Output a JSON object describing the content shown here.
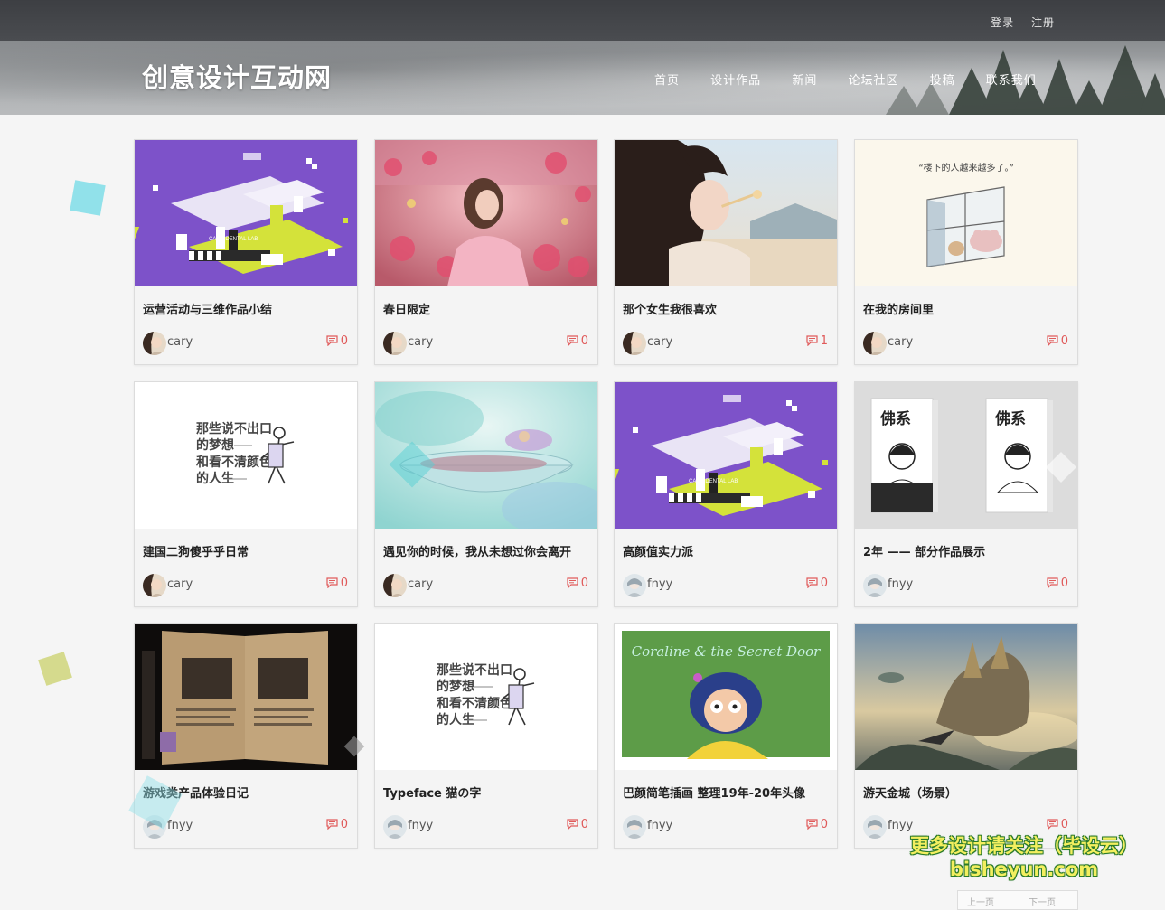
{
  "topbar": {
    "login": "登录",
    "register": "注册"
  },
  "site": {
    "name": "创意设计互动网"
  },
  "nav": [
    "首页",
    "设计作品",
    "新闻",
    "论坛社区",
    "投稿",
    "联系我们"
  ],
  "cards": [
    {
      "title": "运营活动与三维作品小结",
      "author": "cary",
      "comments": "0",
      "thumb": "purple-lab"
    },
    {
      "title": "春日限定",
      "author": "cary",
      "comments": "0",
      "thumb": "flower-girl"
    },
    {
      "title": "那个女生我很喜欢",
      "author": "cary",
      "comments": "1",
      "thumb": "beach-girl"
    },
    {
      "title": "在我的房间里",
      "author": "cary",
      "comments": "0",
      "thumb": "window-sketch"
    },
    {
      "title": "建国二狗傻乎乎日常",
      "author": "cary",
      "comments": "0",
      "thumb": "dream-text"
    },
    {
      "title": "遇见你的时候，我从未想过你会离开",
      "author": "cary",
      "comments": "0",
      "thumb": "teal-bowl"
    },
    {
      "title": "高颜值实力派",
      "author": "fnyy",
      "comments": "0",
      "thumb": "purple-lab"
    },
    {
      "title": "2年 —— 部分作品展示",
      "author": "fnyy",
      "comments": "0",
      "thumb": "books"
    },
    {
      "title": "游戏类产品体验日记",
      "author": "fnyy",
      "comments": "0",
      "thumb": "game-book"
    },
    {
      "title": "Typeface 猫の字",
      "author": "fnyy",
      "comments": "0",
      "thumb": "dream-text"
    },
    {
      "title": "巴颜简笔插画 整理19年-20年头像",
      "author": "fnyy",
      "comments": "0",
      "thumb": "coraline"
    },
    {
      "title": "游天金城（场景）",
      "author": "fnyy",
      "comments": "0",
      "thumb": "fantasy-city"
    }
  ],
  "thumb_text": {
    "lab_label": "CARE DENTAL LAB",
    "dream_lines": [
      "那些说不出口",
      "的梦想",
      "和看不清颜色",
      "的人生"
    ],
    "window_caption": "“楼下的人越来越多了。”",
    "book_title": "佛系",
    "coraline_text": "Coraline & the Secret Door"
  },
  "watermark": {
    "line1": "更多设计请关注（毕设云）",
    "line2": "bisheyun.com"
  },
  "pager": {
    "prev": "上一页",
    "next": "下一页"
  },
  "colors": {
    "topbar": "#3d3f43",
    "comment": "#e05a5a",
    "purple": "#7d52c9",
    "lime": "#d4e23a"
  }
}
